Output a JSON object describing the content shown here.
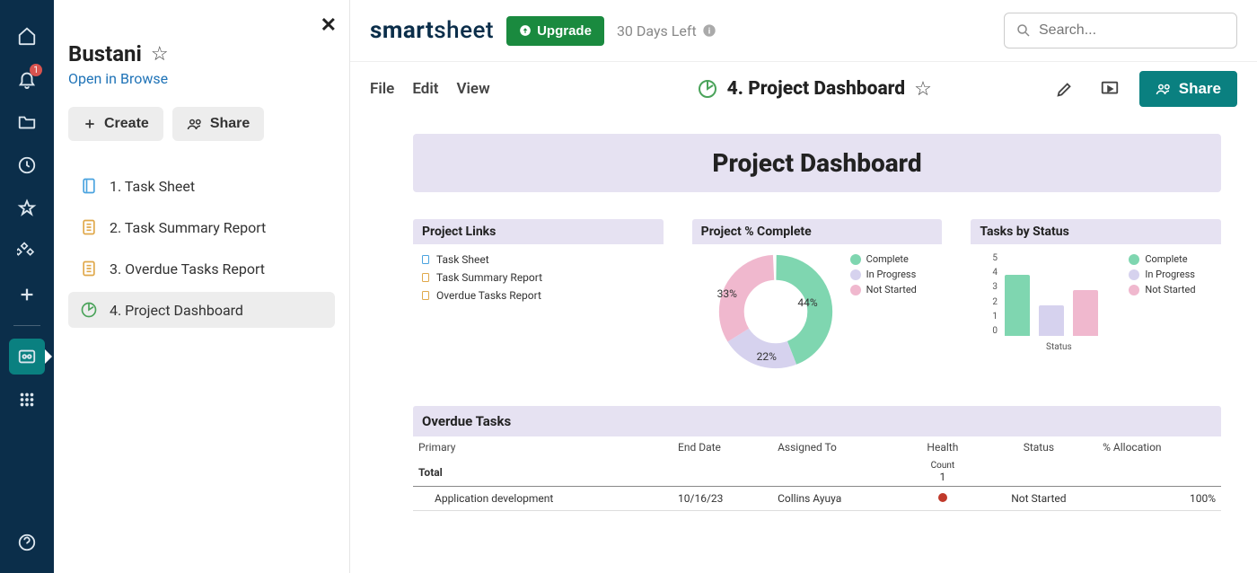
{
  "rail": {
    "notification_count": "1"
  },
  "panel": {
    "title": "Bustani",
    "open_link": "Open in Browse",
    "create_label": "Create",
    "share_label": "Share",
    "items": [
      {
        "label": "1. Task Sheet"
      },
      {
        "label": "2. Task Summary Report"
      },
      {
        "label": "3. Overdue Tasks Report"
      },
      {
        "label": "4. Project Dashboard"
      }
    ]
  },
  "topbar": {
    "brand1": "smart",
    "brand2": "sheet",
    "upgrade": "Upgrade",
    "trial": "30 Days Left",
    "search_placeholder": "Search..."
  },
  "menubar": {
    "file": "File",
    "edit": "Edit",
    "view": "View",
    "doc_title": "4. Project Dashboard",
    "share": "Share"
  },
  "dashboard": {
    "header": "Project Dashboard",
    "links_title": "Project Links",
    "links": [
      {
        "label": "Task Sheet"
      },
      {
        "label": "Task Summary Report"
      },
      {
        "label": "Overdue Tasks Report"
      }
    ],
    "pct_title": "Project % Complete",
    "tasks_title": "Tasks by Status",
    "legend": {
      "c": "Complete",
      "p": "In Progress",
      "n": "Not Started"
    },
    "overdue_title": "Overdue Tasks",
    "columns": {
      "primary": "Primary",
      "end": "End Date",
      "assigned": "Assigned To",
      "health": "Health",
      "status": "Status",
      "alloc": "% Allocation"
    },
    "total_label": "Total",
    "count_label": "Count",
    "count_value": "1",
    "row": {
      "primary": "Application development",
      "end": "10/16/23",
      "assigned": "Collins Ayuya",
      "status": "Not Started",
      "alloc": "100%"
    }
  },
  "chart_data": [
    {
      "type": "pie",
      "title": "Project % Complete",
      "series": [
        {
          "name": "Complete",
          "value": 44,
          "color": "#7fd6b0"
        },
        {
          "name": "In Progress",
          "value": 22,
          "color": "#d6d2ee"
        },
        {
          "name": "Not Started",
          "value": 33,
          "color": "#f0b8ce"
        }
      ],
      "labels_shown": [
        "44%",
        "22%",
        "33%"
      ]
    },
    {
      "type": "bar",
      "title": "Tasks by Status",
      "xlabel": "Status",
      "ylabel": "",
      "ylim": [
        0,
        5
      ],
      "yticks": [
        0,
        1,
        2,
        3,
        4,
        5
      ],
      "categories": [
        "Complete",
        "In Progress",
        "Not Started"
      ],
      "values": [
        4,
        2,
        3
      ],
      "colors": [
        "#7fd6b0",
        "#d6d2ee",
        "#f0b8ce"
      ]
    }
  ]
}
